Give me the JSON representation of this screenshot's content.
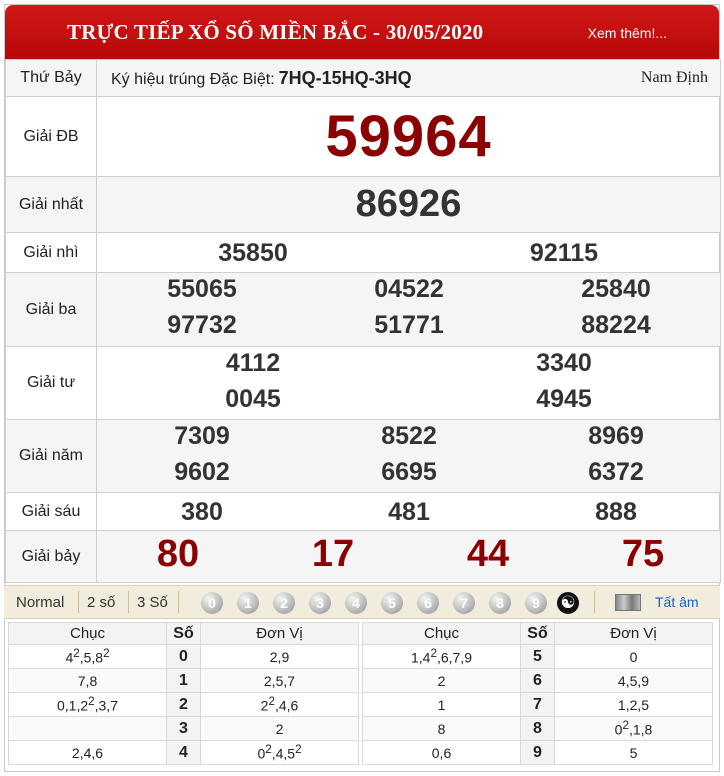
{
  "header": {
    "title": "TRỰC TIẾP XỔ SỐ MIỀN BẮC - 30/05/2020",
    "more_link": "Xem thêm!..."
  },
  "info": {
    "day": "Thứ Bảy",
    "code_label": "Ký hiệu trúng Đặc Biệt:",
    "code_value": "7HQ-15HQ-3HQ",
    "province": "Nam Định"
  },
  "prizes": {
    "db": {
      "label": "Giải ĐB",
      "numbers": [
        "59964"
      ]
    },
    "nhat": {
      "label": "Giải nhất",
      "numbers": [
        "86926"
      ]
    },
    "nhi": {
      "label": "Giải nhì",
      "numbers": [
        "35850",
        "92115"
      ]
    },
    "ba": {
      "label": "Giải ba",
      "numbers": [
        "55065",
        "04522",
        "25840",
        "97732",
        "51771",
        "88224"
      ]
    },
    "tu": {
      "label": "Giải tư",
      "numbers": [
        "4112",
        "3340",
        "0045",
        "4945"
      ]
    },
    "nam": {
      "label": "Giải năm",
      "numbers": [
        "7309",
        "8522",
        "8969",
        "9602",
        "6695",
        "6372"
      ]
    },
    "sau": {
      "label": "Giải sáu",
      "numbers": [
        "380",
        "481",
        "888"
      ]
    },
    "bay": {
      "label": "Giải bảy",
      "numbers": [
        "80",
        "17",
        "44",
        "75"
      ]
    }
  },
  "controls": {
    "modes": [
      "Normal",
      "2 số",
      "3 Số"
    ],
    "digits": [
      "0",
      "1",
      "2",
      "3",
      "4",
      "5",
      "6",
      "7",
      "8",
      "9"
    ],
    "show_all": "Tất âm"
  },
  "loto": {
    "headers": [
      "Chục",
      "Số",
      "Đơn Vị"
    ],
    "rows": [
      {
        "chuc": "4<sup>2</sup>,5,8<sup>2</sup>",
        "so": "0",
        "donvi": "2,9"
      },
      {
        "chuc": "7,8",
        "so": "1",
        "donvi": "2,5,7"
      },
      {
        "chuc": "0,1,2<sup>2</sup>,3,7",
        "so": "2",
        "donvi": "2<sup>2</sup>,4,6"
      },
      {
        "chuc": "",
        "so": "3",
        "donvi": "2"
      },
      {
        "chuc": "2,4,6",
        "so": "4",
        "donvi": "0<sup>2</sup>,4,5<sup>2</sup>"
      },
      {
        "chuc": "1,4<sup>2</sup>,6,7,9",
        "so": "5",
        "donvi": "0"
      },
      {
        "chuc": "2",
        "so": "6",
        "donvi": "4,5,9"
      },
      {
        "chuc": "1",
        "so": "7",
        "donvi": "1,2,5"
      },
      {
        "chuc": "8",
        "so": "8",
        "donvi": "0<sup>2</sup>,1,8"
      },
      {
        "chuc": "0,6",
        "so": "9",
        "donvi": "5"
      }
    ]
  }
}
